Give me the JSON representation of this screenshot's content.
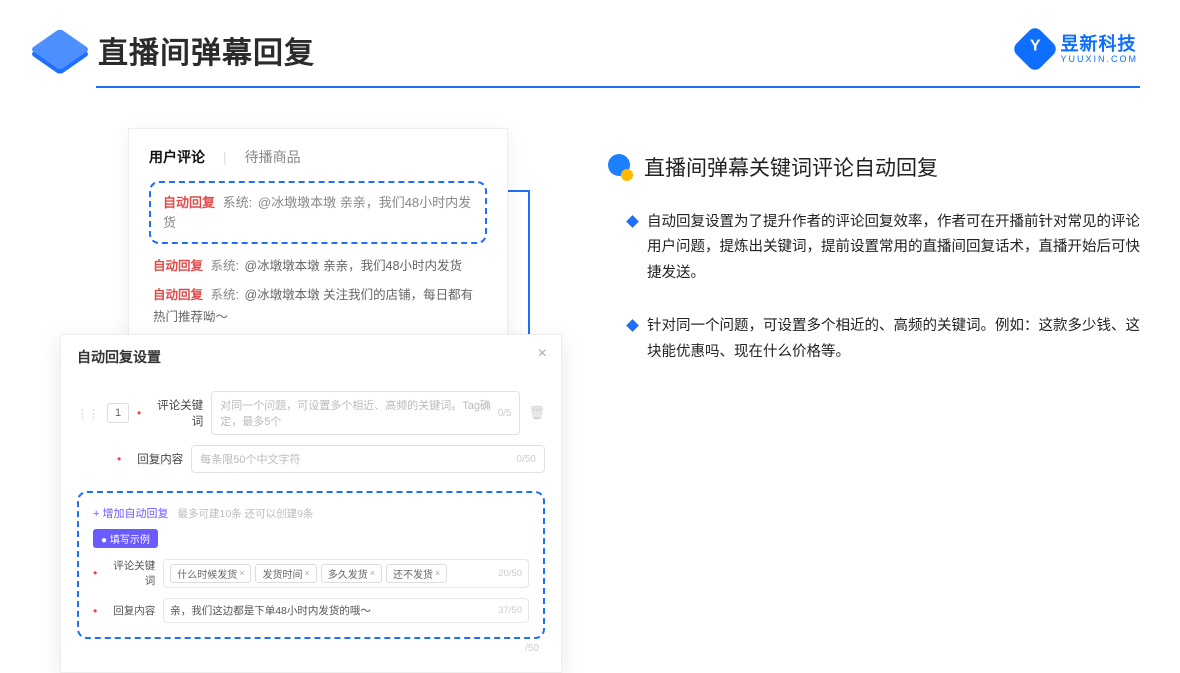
{
  "header": {
    "title": "直播间弹幕回复"
  },
  "brand": {
    "cn": "昱新科技",
    "en": "YUUXIN.COM",
    "letter": "Y"
  },
  "comments_card": {
    "tab_active": "用户评论",
    "tab_inactive": "待播商品",
    "highlight": {
      "auto": "自动回复",
      "sys": "系统:",
      "text": "@冰墩墩本墩 亲亲，我们48小时内发货"
    },
    "line2": {
      "auto": "自动回复",
      "sys": "系统:",
      "text": "@冰墩墩本墩 亲亲，我们48小时内发货"
    },
    "line3": {
      "auto": "自动回复",
      "sys": "系统:",
      "text": "@冰墩墩本墩 关注我们的店铺，每日都有热门推荐呦～"
    }
  },
  "settings": {
    "title": "自动回复设置",
    "num": "1",
    "label_keyword": "评论关键词",
    "placeholder_keyword": "对同一个问题，可设置多个相近、高频的关键词。Tag确定，最多5个",
    "count_keyword": "0/5",
    "label_content": "回复内容",
    "placeholder_content": "每条限50个中文字符",
    "count_content": "0/50",
    "add_link": "+ 增加自动回复",
    "add_hint": "最多可建10条 还可以创建9条",
    "example_badge": "● 填写示例",
    "ex_label_kw": "评论关键词",
    "ex_tags": [
      "什么时候发货",
      "发货时间",
      "多久发货",
      "还不发货"
    ],
    "ex_kw_count": "20/50",
    "ex_label_ct": "回复内容",
    "ex_content": "亲，我们这边都是下单48小时内发货的哦～",
    "ex_ct_count": "37/50",
    "outer_count": "/50"
  },
  "right": {
    "title": "直播间弹幕关键词评论自动回复",
    "bullet1": "自动回复设置为了提升作者的评论回复效率，作者可在开播前针对常见的评论用户问题，提炼出关键词，提前设置常用的直播间回复话术，直播开始后可快捷发送。",
    "bullet2": "针对同一个问题，可设置多个相近的、高频的关键词。例如：这款多少钱、这块能优惠吗、现在什么价格等。"
  }
}
